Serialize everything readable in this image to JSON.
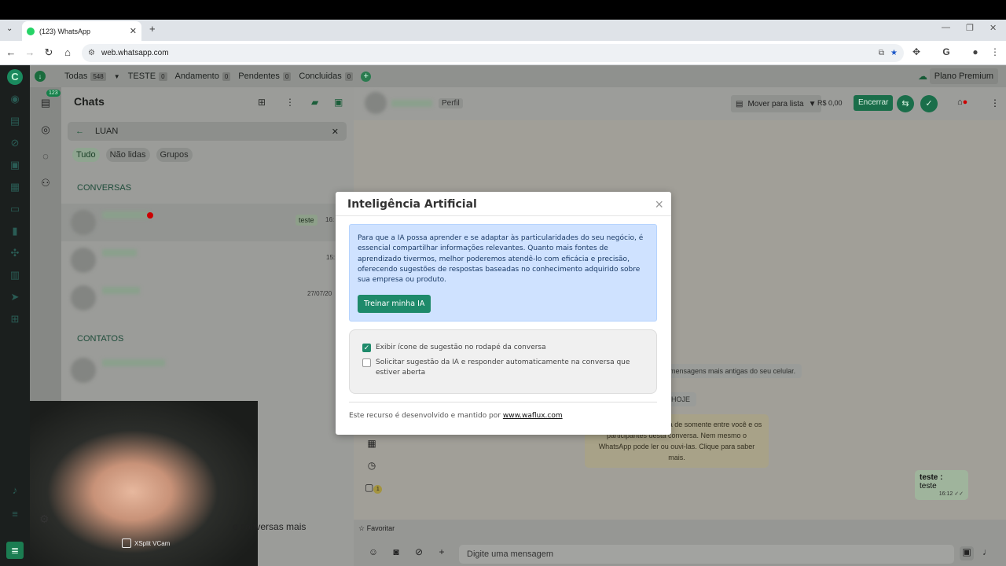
{
  "browser": {
    "tab_title": "(123) WhatsApp",
    "url": "web.whatsapp.com"
  },
  "filters": {
    "items": [
      {
        "label": "Todas",
        "count": "548"
      },
      {
        "label": "TESTE",
        "count": "0"
      },
      {
        "label": "Andamento",
        "count": "0"
      },
      {
        "label": "Pendentes",
        "count": "0"
      },
      {
        "label": "Concluidas",
        "count": "0"
      }
    ],
    "premium_label": "Plano Premium"
  },
  "sidebar": {
    "badge": "123"
  },
  "chats": {
    "title": "Chats",
    "search_value": "LUAN",
    "chips": [
      "Tudo",
      "Não lidas",
      "Grupos"
    ],
    "section_conversas": "CONVERSAS",
    "section_contatos": "CONTATOS",
    "rows": [
      {
        "tag": "teste",
        "time": "16:"
      },
      {
        "time": "15:"
      },
      {
        "time": "27/07/20"
      }
    ],
    "overlap_text": "e conversas mais"
  },
  "chat": {
    "perfil_label": "Perfil",
    "move_label": "Mover para lista",
    "price": "R$ 0,00",
    "encerrar_label": "Encerrar",
    "sys_old_msgs": "mensagens mais antigas do seu celular.",
    "day_label": "HOJE",
    "encryption_text": "tegidas com a criptografia de somente entre você e os participantes desta conversa. Nem mesmo o WhatsApp pode ler ou ouvi-las. Clique para saber mais.",
    "bubble_title": "teste :",
    "bubble_text": "teste",
    "bubble_time": "16:12",
    "favoritar": "Favoritar",
    "input_placeholder": "Digite uma mensagem",
    "notes_count": "1"
  },
  "webcam": {
    "label": "XSplit VCam"
  },
  "modal": {
    "title": "Inteligência Artificial",
    "info_text": "Para que a IA possa aprender e se adaptar às particularidades do seu negócio, é essencial compartilhar informações relevantes. Quanto mais fontes de aprendizado tivermos, melhor poderemos atendê-lo com eficácia e precisão, oferecendo sugestões de respostas baseadas no conhecimento adquirido sobre sua empresa ou produto.",
    "train_button": "Treinar minha IA",
    "option1": "Exibir ícone de sugestão no rodapé da conversa",
    "option1_checked": true,
    "option2": "Solicitar sugestão da IA e responder automaticamente na conversa que estiver aberta",
    "option2_checked": false,
    "footer_prefix": "Este recurso é desenvolvido e mantido por",
    "footer_link": "www.waflux.com"
  }
}
